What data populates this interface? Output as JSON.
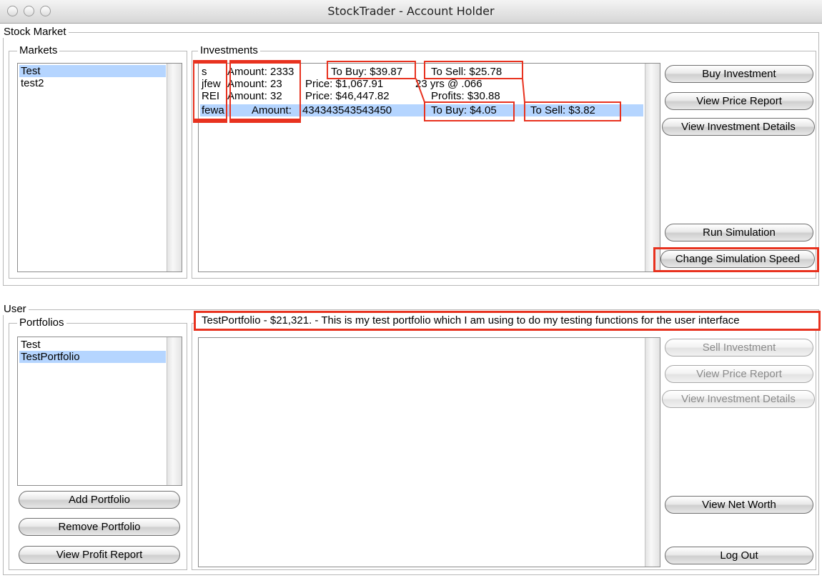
{
  "window": {
    "title": "StockTrader - Account Holder"
  },
  "stock_market": {
    "group_label": "Stock Market",
    "markets": {
      "label": "Markets",
      "items": [
        "Test",
        "test2"
      ],
      "selected_index": 0
    },
    "investments": {
      "label": "Investments",
      "rows": [
        {
          "code": "s",
          "amount": "Amount: 2333",
          "col3": "To Buy: $39.87",
          "col4": "To Sell: $25.78",
          "col5": ""
        },
        {
          "code": "jfew",
          "amount": "Amount: 23",
          "col3": "Price: $1,067.91",
          "col4": "23 yrs @ .066",
          "col5": ""
        },
        {
          "code": "REI",
          "amount": "Amount: 32",
          "col3": "Price: $46,447.82",
          "col4": "Profits: $30.88",
          "col5": ""
        },
        {
          "code": "fewa",
          "amount": "Amount:",
          "amount_value": "434343543543450",
          "col3": "To Buy: $4.05",
          "col4": "To Sell: $3.82",
          "col5": ""
        }
      ],
      "selected_index": 3
    },
    "buttons": {
      "buy": "Buy Investment",
      "price_report": "View Price Report",
      "details": "View Investment Details",
      "run_sim": "Run Simulation",
      "change_speed": "Change Simulation Speed"
    }
  },
  "user": {
    "group_label": "User",
    "portfolios": {
      "label": "Portfolios",
      "items": [
        "Test",
        "TestPortfolio"
      ],
      "selected_index": 1
    },
    "portfolio_description": "TestPortfolio - $21,321. - This is my test portfolio which I am using to do my testing functions for the user interface",
    "buttons": {
      "add": "Add Portfolio",
      "remove": "Remove Portfolio",
      "profit_report": "View Profit Report",
      "sell": "Sell Investment",
      "price_report": "View Price Report",
      "details": "View Investment Details",
      "net_worth": "View Net Worth",
      "logout": "Log Out"
    }
  },
  "colors": {
    "selection": "#b5d5ff",
    "annotation": "#e8321f"
  }
}
